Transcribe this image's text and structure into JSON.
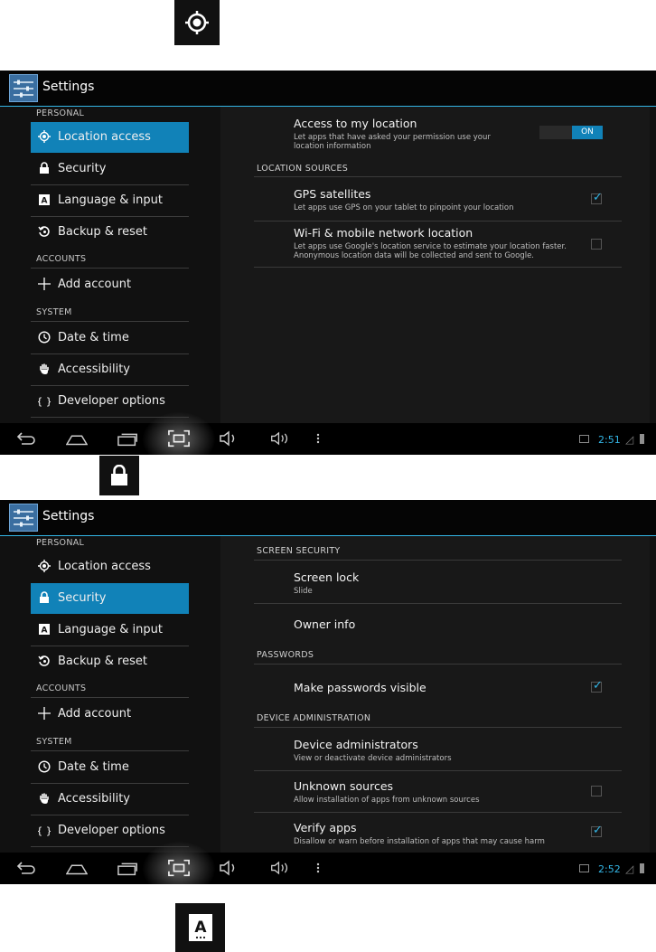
{
  "app": {
    "title": "Settings"
  },
  "sidebar": {
    "headers": {
      "personal": "PERSONAL",
      "accounts": "ACCOUNTS",
      "system": "SYSTEM"
    },
    "items": [
      {
        "label": "Location access",
        "icon": "location-icon"
      },
      {
        "label": "Security",
        "icon": "lock-icon"
      },
      {
        "label": "Language & input",
        "icon": "keyboard-a-icon"
      },
      {
        "label": "Backup & reset",
        "icon": "backup-icon"
      },
      {
        "label": "Add account",
        "icon": "plus-icon"
      },
      {
        "label": "Date & time",
        "icon": "clock-icon"
      },
      {
        "label": "Accessibility",
        "icon": "hand-icon"
      },
      {
        "label": "Developer options",
        "icon": "braces-icon"
      }
    ]
  },
  "location_screen": {
    "access": {
      "title": "Access to my location",
      "subtitle": "Let apps that have asked your permission use your location information",
      "toggle": "ON"
    },
    "section_sources": "LOCATION SOURCES",
    "gps": {
      "title": "GPS satellites",
      "subtitle": "Let apps use GPS on your tablet to pinpoint your location",
      "checked": true
    },
    "wifi": {
      "title": "Wi-Fi & mobile network location",
      "subtitle": "Let apps use Google's location service to estimate your location faster. Anonymous location data will be collected and sent to Google.",
      "checked": false
    },
    "clock": "2:51"
  },
  "security_screen": {
    "section_screen": "SCREEN SECURITY",
    "screen_lock": {
      "title": "Screen lock",
      "subtitle": "Slide"
    },
    "owner_info": {
      "title": "Owner info"
    },
    "section_passwords": "PASSWORDS",
    "make_visible": {
      "title": "Make passwords visible",
      "checked": true
    },
    "section_admin": "DEVICE ADMINISTRATION",
    "device_admins": {
      "title": "Device administrators",
      "subtitle": "View or deactivate device administrators"
    },
    "unknown_sources": {
      "title": "Unknown sources",
      "subtitle": "Allow installation of apps from unknown sources",
      "checked": false
    },
    "verify_apps": {
      "title": "Verify apps",
      "subtitle": "Disallow or warn before installation of apps that may cause harm",
      "checked": true
    },
    "clock": "2:52"
  },
  "colors": {
    "accent": "#33b5e5",
    "selected": "#1182b8",
    "background": "#111111"
  }
}
